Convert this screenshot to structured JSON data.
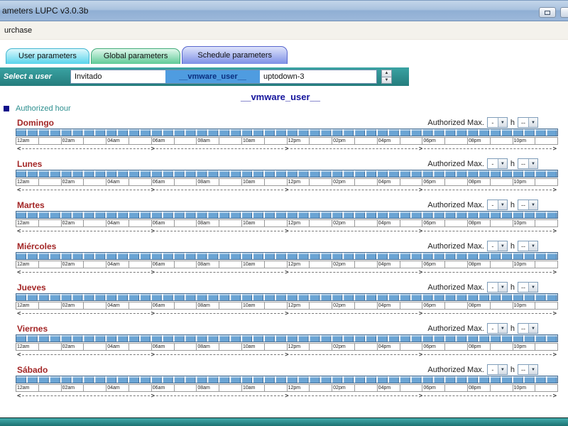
{
  "window": {
    "title": "ameters LUPC v3.0.3b"
  },
  "menu": {
    "items": [
      {
        "label": "urchase"
      }
    ]
  },
  "tabs": [
    {
      "label": "User parameters",
      "active": false
    },
    {
      "label": "Global parameters",
      "active": false
    },
    {
      "label": "Schedule parameters",
      "active": true
    }
  ],
  "user_select": {
    "label": "Select a user",
    "users": [
      {
        "name": "Invitado",
        "selected": false
      },
      {
        "name": "__vmware_user__",
        "selected": true
      },
      {
        "name": "uptodown-3",
        "selected": false
      }
    ]
  },
  "selected_user_title": "__vmware_user__",
  "legend": {
    "authorized_hour_label": "Authorized hour"
  },
  "schedule": {
    "days": [
      "Domingo",
      "Lunes",
      "Martes",
      "Miércoles",
      "Jueves",
      "Viernes",
      "Sábado"
    ],
    "authorized_max_label": "Authorized Max.",
    "hour_value": "-",
    "hour_unit": "h",
    "minute_value": "--",
    "time_labels": [
      "12am",
      "02am",
      "04am",
      "06am",
      "08am",
      "10am",
      "12pm",
      "02pm",
      "04pm",
      "06pm",
      "08pm",
      "10pm"
    ]
  },
  "timeline": {
    "arrow_left": "<",
    "arrow_right": ">",
    "segments": 4
  },
  "icons": {
    "dropdown_arrow": "▼",
    "spinner_up": "▲",
    "spinner_down": "▼"
  },
  "colors": {
    "accent_teal": "#2e8f8f",
    "day_label_red": "#a32626",
    "selection_blue": "#4f9ce0",
    "timeline_blue": "#6aa4d4",
    "title_navy": "#14149c"
  }
}
